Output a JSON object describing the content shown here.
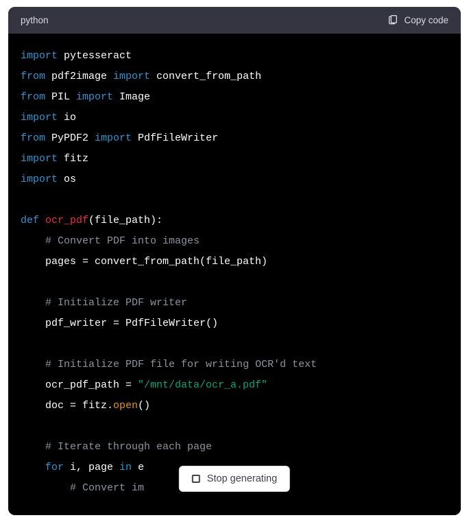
{
  "header": {
    "language": "python",
    "copy_label": "Copy code"
  },
  "stop": {
    "label": "Stop generating"
  },
  "code": {
    "lines": [
      {
        "tokens": [
          {
            "t": "import ",
            "c": "kw"
          },
          {
            "t": "pytesseract",
            "c": "mod"
          }
        ]
      },
      {
        "tokens": [
          {
            "t": "from ",
            "c": "kw"
          },
          {
            "t": "pdf2image ",
            "c": "mod"
          },
          {
            "t": "import ",
            "c": "kw"
          },
          {
            "t": "convert_from_path",
            "c": "mod"
          }
        ]
      },
      {
        "tokens": [
          {
            "t": "from ",
            "c": "kw"
          },
          {
            "t": "PIL ",
            "c": "mod"
          },
          {
            "t": "import ",
            "c": "kw"
          },
          {
            "t": "Image",
            "c": "mod"
          }
        ]
      },
      {
        "tokens": [
          {
            "t": "import ",
            "c": "kw"
          },
          {
            "t": "io",
            "c": "mod"
          }
        ]
      },
      {
        "tokens": [
          {
            "t": "from ",
            "c": "kw"
          },
          {
            "t": "PyPDF2 ",
            "c": "mod"
          },
          {
            "t": "import ",
            "c": "kw"
          },
          {
            "t": "PdfFileWriter",
            "c": "mod"
          }
        ]
      },
      {
        "tokens": [
          {
            "t": "import ",
            "c": "kw"
          },
          {
            "t": "fitz",
            "c": "mod"
          }
        ]
      },
      {
        "tokens": [
          {
            "t": "import ",
            "c": "kw"
          },
          {
            "t": "os",
            "c": "mod"
          }
        ]
      },
      {
        "tokens": [
          {
            "t": "",
            "c": "pln"
          }
        ]
      },
      {
        "tokens": [
          {
            "t": "def ",
            "c": "kw"
          },
          {
            "t": "ocr_pdf",
            "c": "fn"
          },
          {
            "t": "(file_path):",
            "c": "pln"
          }
        ]
      },
      {
        "tokens": [
          {
            "t": "    ",
            "c": "pln"
          },
          {
            "t": "# Convert PDF into images",
            "c": "cmt"
          }
        ]
      },
      {
        "tokens": [
          {
            "t": "    pages = convert_from_path(file_path)",
            "c": "pln"
          }
        ]
      },
      {
        "tokens": [
          {
            "t": "",
            "c": "pln"
          }
        ]
      },
      {
        "tokens": [
          {
            "t": "    ",
            "c": "pln"
          },
          {
            "t": "# Initialize PDF writer",
            "c": "cmt"
          }
        ]
      },
      {
        "tokens": [
          {
            "t": "    pdf_writer = PdfFileWriter()",
            "c": "pln"
          }
        ]
      },
      {
        "tokens": [
          {
            "t": "",
            "c": "pln"
          }
        ]
      },
      {
        "tokens": [
          {
            "t": "    ",
            "c": "pln"
          },
          {
            "t": "# Initialize PDF file for writing OCR'd text",
            "c": "cmt"
          }
        ]
      },
      {
        "tokens": [
          {
            "t": "    ocr_pdf_path = ",
            "c": "pln"
          },
          {
            "t": "\"/mnt/data/ocr_a.pdf\"",
            "c": "str"
          }
        ]
      },
      {
        "tokens": [
          {
            "t": "    doc = fitz.",
            "c": "pln"
          },
          {
            "t": "open",
            "c": "call"
          },
          {
            "t": "()",
            "c": "pln"
          }
        ]
      },
      {
        "tokens": [
          {
            "t": "",
            "c": "pln"
          }
        ]
      },
      {
        "tokens": [
          {
            "t": "    ",
            "c": "pln"
          },
          {
            "t": "# Iterate through each page",
            "c": "cmt"
          }
        ]
      },
      {
        "tokens": [
          {
            "t": "    ",
            "c": "pln"
          },
          {
            "t": "for ",
            "c": "kw"
          },
          {
            "t": "i, page ",
            "c": "pln"
          },
          {
            "t": "in ",
            "c": "kw"
          },
          {
            "t": "e",
            "c": "pln"
          }
        ]
      },
      {
        "tokens": [
          {
            "t": "        ",
            "c": "pln"
          },
          {
            "t": "# Convert im",
            "c": "cmt"
          }
        ]
      }
    ]
  }
}
